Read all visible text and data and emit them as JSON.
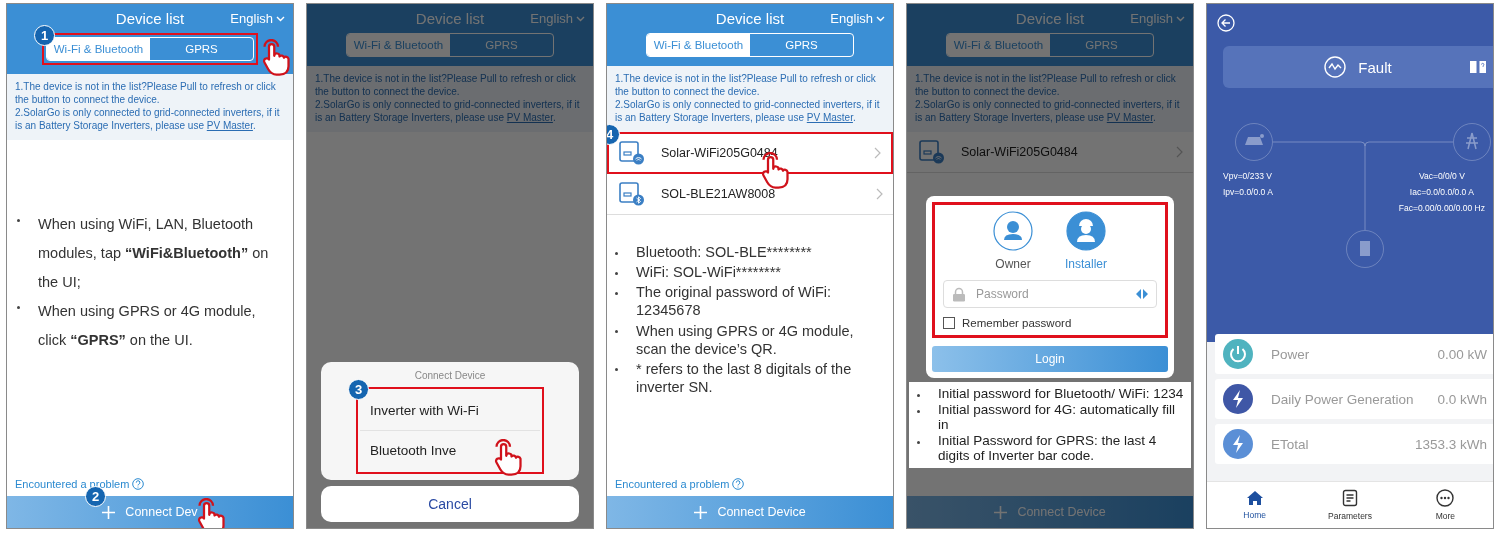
{
  "panels": [
    {
      "kind": "device_list",
      "dimmed": false,
      "title": "Device list",
      "language": "English",
      "tabs": [
        {
          "label": "Wi-Fi & Bluetooth",
          "selected": true
        },
        {
          "label": "GPRS",
          "selected": false
        }
      ],
      "tabs_step": "1",
      "tabs_tapped": true,
      "hint": {
        "lines": [
          "1.The device is not in the list?Please Pull to refresh or click the button to connect the device.",
          "2.SolarGo is only connected to grid-connected inverters, if it is an Battery Storage Inverters, please use "
        ],
        "link": "PV Master",
        "after_link": "."
      },
      "notes": [
        [
          {
            "text": "When using WiFi, LAN, Bluetooth modules, tap ",
            "bold": false
          },
          {
            "text": "“WiFi&Bluetooth”",
            "bold": true
          },
          {
            "text": " on the UI;",
            "bold": false
          }
        ],
        [
          {
            "text": "When using GPRS or 4G module, click ",
            "bold": false
          },
          {
            "text": "“GPRS”",
            "bold": true
          },
          {
            "text": " on the UI.",
            "bold": false
          }
        ]
      ],
      "problem_link": "Encountered a problem",
      "connect": {
        "label": "Connect Dev",
        "step": "2",
        "tapped": true
      }
    },
    {
      "kind": "device_list",
      "dimmed": true,
      "title": "Device list",
      "language": "English",
      "tabs": [
        {
          "label": "Wi-Fi & Bluetooth",
          "selected": true
        },
        {
          "label": "GPRS",
          "selected": false
        }
      ],
      "hint": {
        "lines": [
          "1.The device is not in the list?Please Pull to refresh or click the button to connect the device.",
          "2.SolarGo is only connected to grid-connected inverters, if it is an Battery Storage Inverters, please use "
        ],
        "link": "PV Master",
        "after_link": "."
      },
      "sheet": {
        "title": "Connect Device",
        "step": "3",
        "options": [
          {
            "label": "Inverter with Wi-Fi",
            "tapped": false
          },
          {
            "label": "Bluetooth Inve",
            "tapped": true
          }
        ],
        "cancel": "Cancel"
      }
    },
    {
      "kind": "device_list",
      "dimmed": false,
      "title": "Device list",
      "language": "English",
      "tabs": [
        {
          "label": "Wi-Fi & Bluetooth",
          "selected": true
        },
        {
          "label": "GPRS",
          "selected": false
        }
      ],
      "hint": {
        "lines": [
          "1.The device is not in the list?Please Pull to refresh or click the button to connect the device.",
          "2.SolarGo is only connected to grid-connected inverters, if it is an Battery Storage Inverters, please use "
        ],
        "link": "PV Master",
        "after_link": "."
      },
      "devices": [
        {
          "name": "Solar-WiFi205G0484",
          "kind": "wifi",
          "step": "4",
          "tapped": true
        },
        {
          "name": "SOL-BLE21AW8008",
          "kind": "bluetooth"
        }
      ],
      "notes": [
        "Bluetooth: SOL-BLE********",
        "WiFi: SOL-WiFi********",
        "The original password of WiFi: 12345678",
        "When using GPRS or 4G module, scan the device’s QR.",
        "* refers to the last 8 digitals of the inverter SN."
      ],
      "problem_link": "Encountered a problem",
      "connect": {
        "label": "Connect Device"
      }
    },
    {
      "kind": "device_list",
      "dimmed": true,
      "title": "Device list",
      "language": "English",
      "tabs": [
        {
          "label": "Wi-Fi & Bluetooth",
          "selected": true
        },
        {
          "label": "GPRS",
          "selected": false
        }
      ],
      "hint": {
        "lines": [
          "1.The device is not in the list?Please Pull to refresh or click the button to connect the device.",
          "2.SolarGo is only connected to grid-connected inverters, if it is an Battery Storage Inverters, please use "
        ],
        "link": "PV Master",
        "after_link": "."
      },
      "devices": [
        {
          "name": "Solar-WiFi205G0484",
          "kind": "wifi"
        }
      ],
      "dialog": {
        "framed": true,
        "roles": [
          {
            "label": "Owner",
            "kind": "owner",
            "selected": false
          },
          {
            "label": "Installer",
            "kind": "installer",
            "selected": true
          }
        ],
        "password_placeholder": "Password",
        "remember": {
          "label": "Remember password",
          "checked": false
        },
        "login": "Login"
      },
      "notes": [
        "Initial password for Bluetooth/ WiFi: 1234",
        "Initial password for 4G: automatically fill in",
        "Initial Password for GPRS: the last 4 digits of Inverter bar code."
      ],
      "connect": {
        "label": "Connect Device"
      }
    },
    {
      "kind": "dashboard",
      "status": "Fault",
      "pv_readings": [
        "Vpv=0/233 V",
        "Ipv=0.0/0.0 A"
      ],
      "grid_readings": [
        "Vac=0/0/0 V",
        "Iac=0.0/0.0/0.0 A",
        "Fac=0.00/0.00/0.00 Hz"
      ],
      "metrics": [
        {
          "label": "Power",
          "value": "0.00 kW",
          "kind": "power",
          "color": "#4fb3bf"
        },
        {
          "label": "Daily Power Generation",
          "value": "0.0 kWh",
          "kind": "energy",
          "color": "#3f57a6"
        },
        {
          "label": "ETotal",
          "value": "1353.3 kWh",
          "kind": "energy",
          "color": "#5b8fd6"
        }
      ],
      "nav": [
        {
          "label": "Home",
          "kind": "home",
          "selected": true
        },
        {
          "label": "Parameters",
          "kind": "parameters",
          "selected": false
        },
        {
          "label": "More",
          "kind": "more",
          "selected": false
        }
      ]
    }
  ]
}
